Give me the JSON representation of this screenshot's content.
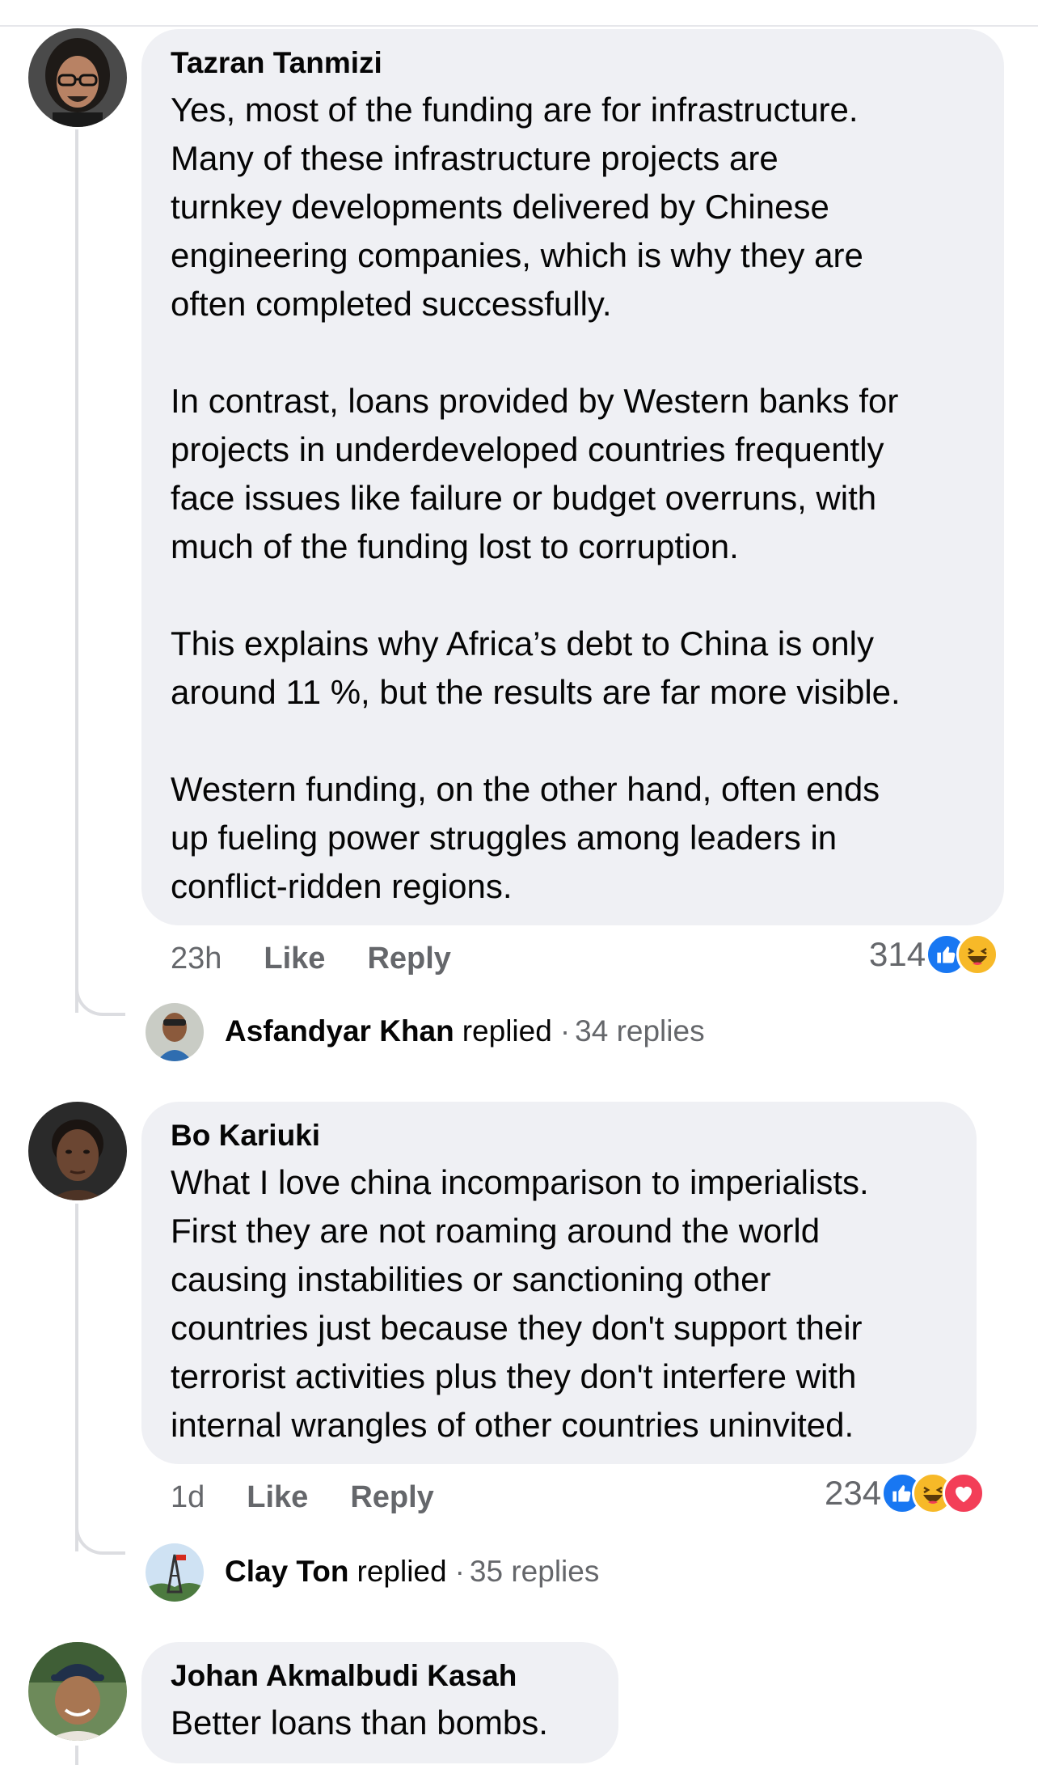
{
  "comments": [
    {
      "author": "Tazran Tanmizi",
      "text": "Yes, most of the funding are for infrastructure.\nMany of these infrastructure projects are\nturnkey developments delivered by Chinese\nengineering companies, which is why they are\noften completed successfully.\n\nIn contrast, loans provided by Western banks for\nprojects in underdeveloped countries frequently\nface issues like failure or budget overruns, with\nmuch of the funding lost to corruption.\n\nThis explains why Africa’s debt to China is only\naround 11 %, but the results are far more visible.\n\nWestern funding, on the other hand, often ends\nup fueling power struggles among leaders in\nconflict-ridden regions.",
      "time": "23h",
      "like_label": "Like",
      "reply_label": "Reply",
      "reaction_count": "314",
      "reactions": [
        "like-icon",
        "haha-icon"
      ],
      "reply_author": "Asfandyar Khan",
      "reply_verb": "replied",
      "reply_count": "34 replies"
    },
    {
      "author": "Bo Kariuki",
      "text": "What I love china incomparison to imperialists.\nFirst they are not roaming around the world\ncausing instabilities or sanctioning other\ncountries just because they don't support their\nterrorist activities plus they don't interfere with\ninternal wrangles of other countries uninvited.",
      "time": "1d",
      "like_label": "Like",
      "reply_label": "Reply",
      "reaction_count": "234",
      "reactions": [
        "like-icon",
        "haha-icon",
        "love-icon"
      ],
      "reply_author": "Clay Ton",
      "reply_verb": "replied",
      "reply_count": "35 replies"
    },
    {
      "author": "Johan Akmalbudi Kasah",
      "text": "Better loans than bombs."
    }
  ],
  "colors": {
    "bubble": "#eff0f4",
    "like_blue": "#1877f2",
    "haha_yellow": "#f7b928",
    "love_red": "#f33e58",
    "muted_text": "#65676b"
  }
}
